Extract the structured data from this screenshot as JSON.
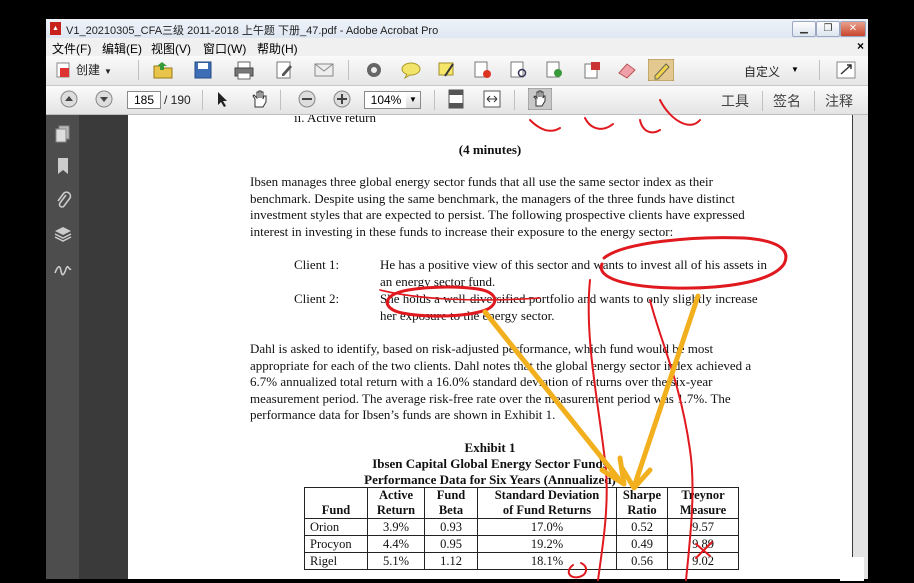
{
  "window": {
    "title": "V1_20210305_CFA三级 2011-2018 上午题 下册_47.pdf - Adobe Acrobat Pro",
    "controls": {
      "minimize": "▁",
      "restore": "❐",
      "close": "✕"
    }
  },
  "menu": {
    "items": [
      "文件(F)",
      "编辑(E)",
      "视图(V)",
      "窗口(W)",
      "帮助(H)"
    ],
    "close_glyph": "×"
  },
  "toolbar": {
    "create_label": "创建",
    "customize_label": "自定义"
  },
  "nav": {
    "current_page": "185",
    "total_pages": "/ 190",
    "zoom": "104%",
    "tools_label": "工具",
    "sign_label": "签名",
    "comment_label": "注释"
  },
  "document": {
    "cut_line": "ii.     Active return",
    "minutes": "(4 minutes)",
    "intro": [
      "Ibsen manages three global energy sector funds that all use the same sector index as their",
      "benchmark.  Despite using the same benchmark, the managers of the three funds have distinct",
      "investment styles that are expected to persist.  The following prospective clients have expressed",
      "interest in investing in these funds to increase their exposure to the energy sector:"
    ],
    "clients": [
      {
        "label": "Client 1:",
        "lines": [
          "He has a positive view of this sector and wants to invest all of his assets in",
          "an energy sector fund."
        ]
      },
      {
        "label": "Client 2:",
        "lines": [
          "She holds a well-diversified portfolio and wants to only slightly increase",
          "her exposure to the energy sector."
        ]
      }
    ],
    "para2": [
      "Dahl is asked to identify, based on risk-adjusted performance, which fund would be most",
      "appropriate for each of the two clients.  Dahl notes that the global energy sector index achieved a",
      "6.7% annualized total return with a 16.0% standard deviation of returns over the six-year",
      "measurement period.  The average risk-free rate over the measurement period was 1.7%.  The",
      "performance data for Ibsen’s funds are shown in Exhibit 1."
    ],
    "exhibit": {
      "title": "Exhibit 1",
      "subtitle": "Ibsen Capital Global Energy Sector Funds",
      "subtitle2": "Performance Data for Six Years (Annualized)",
      "columns": [
        [
          "",
          "Fund"
        ],
        [
          "Active",
          "Return"
        ],
        [
          "Fund",
          "Beta"
        ],
        [
          "Standard Deviation",
          "of Fund Returns"
        ],
        [
          "Sharpe",
          "Ratio"
        ],
        [
          "Treynor",
          "Measure"
        ]
      ],
      "rows": [
        [
          "Orion",
          "3.9%",
          "0.93",
          "17.0%",
          "0.52",
          "9.57"
        ],
        [
          "Procyon",
          "4.4%",
          "0.95",
          "19.2%",
          "0.49",
          "9.89"
        ],
        [
          "Rigel",
          "5.1%",
          "1.12",
          "18.1%",
          "0.56",
          "9.02"
        ]
      ]
    }
  },
  "annotation_colors": {
    "red": "#e0191f",
    "yellow": "#f2b01e"
  }
}
